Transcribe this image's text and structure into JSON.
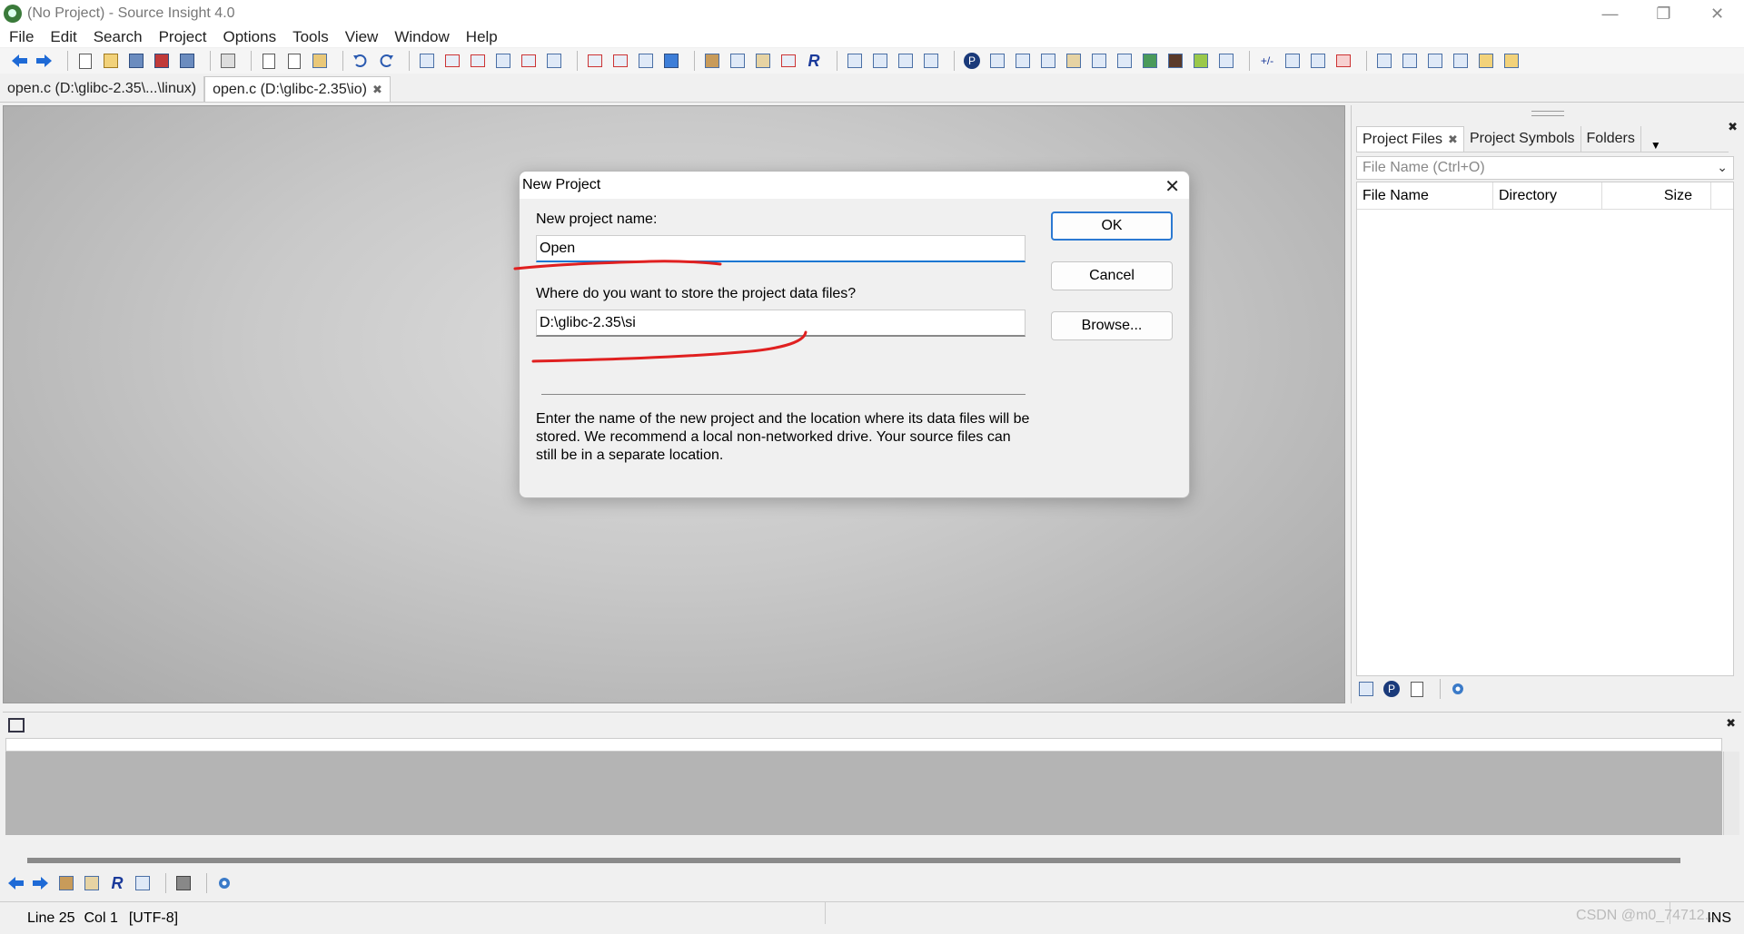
{
  "window": {
    "title": "(No Project) - Source Insight 4.0",
    "controls": [
      "—",
      "❐",
      "✕"
    ]
  },
  "menu": [
    "File",
    "Edit",
    "Search",
    "Project",
    "Options",
    "Tools",
    "View",
    "Window",
    "Help"
  ],
  "tabs": [
    {
      "label": "open.c (D:\\glibc-2.35\\...\\linux)",
      "active": false
    },
    {
      "label": "open.c (D:\\glibc-2.35\\io)",
      "active": true,
      "close": "✖"
    }
  ],
  "project_panel": {
    "tabs": [
      {
        "label": "Project Files",
        "active": true,
        "close": "✖"
      },
      {
        "label": "Project Symbols",
        "active": false
      },
      {
        "label": "Folders",
        "active": false
      }
    ],
    "more": "▼",
    "close": "✖",
    "filter_placeholder": "File Name (Ctrl+O)",
    "filter_arrow": "⌄",
    "columns": [
      "File Name",
      "Directory",
      "Size"
    ]
  },
  "dialog": {
    "title": "New Project",
    "close": "✕",
    "name_label": "New project name:",
    "name_value": "Open",
    "location_label": "Where do you want to store the project data files?",
    "location_value": "D:\\glibc-2.35\\si",
    "ok": "OK",
    "cancel": "Cancel",
    "browse": "Browse...",
    "description": "Enter the name of the new project and the location where its data files will be stored. We recommend a local non-networked drive. Your source files can still be in a separate location."
  },
  "bottom_panel": {
    "close": "✖"
  },
  "status": {
    "line": "Line 25",
    "col": "Col 1",
    "encoding": "[UTF-8]",
    "mode": "INS"
  },
  "watermark": "CSDN @m0_74712... ",
  "colors": {
    "accent": "#2b79d2",
    "annotation": "#e02020"
  }
}
